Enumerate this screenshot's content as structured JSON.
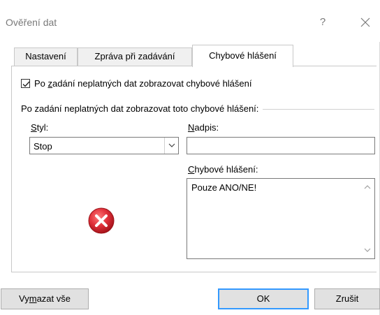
{
  "window": {
    "title": "Ověření dat",
    "help_label": "?"
  },
  "tabs": [
    {
      "label": "Nastavení",
      "active": false
    },
    {
      "label": "Zpráva při zadávání",
      "active": false
    },
    {
      "label": "Chybové hlášení",
      "active": true
    }
  ],
  "error_alert": {
    "show_checkbox": {
      "checked": true,
      "label_prefix": "Po ",
      "label_mnemonic": "z",
      "label_suffix": "adání neplatných dat zobrazovat chybové hlášení"
    },
    "group_label": "Po zadání neplatných dat zobrazovat toto chybové hlášení:",
    "style_label_mnemonic": "S",
    "style_label_suffix": "tyl:",
    "style_value": "Stop",
    "title_label_mnemonic": "N",
    "title_label_suffix": "adpis:",
    "title_value": "",
    "message_label_mnemonic": "C",
    "message_label_suffix": "hybové hlášení:",
    "message_value": "Pouze ANO/NE!",
    "icon": "error-stop-icon"
  },
  "buttons": {
    "clear_prefix": "Vy",
    "clear_mnemonic": "m",
    "clear_suffix": "azat vše",
    "ok": "OK",
    "cancel": "Zrušit"
  },
  "colors": {
    "error_red": "#e0303a",
    "focus_blue": "#3399ff"
  }
}
